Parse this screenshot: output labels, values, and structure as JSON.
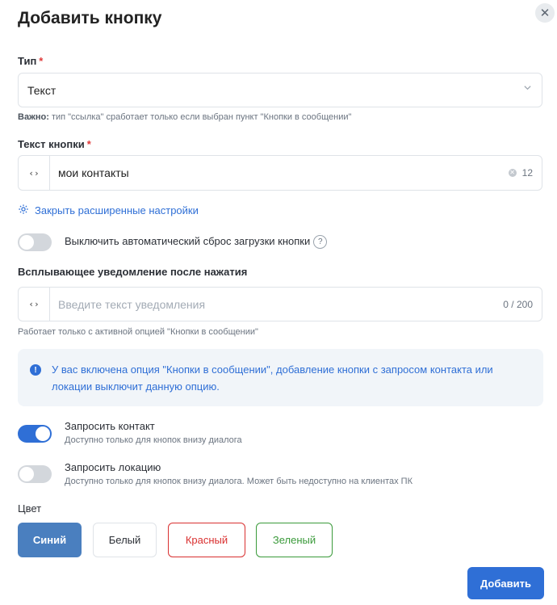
{
  "dialog": {
    "title": "Добавить кнопку",
    "close_label": "✕"
  },
  "type_field": {
    "label": "Тип",
    "required_mark": "*",
    "value": "Текст",
    "note_bold": "Важно:",
    "note_text": " тип \"ссылка\" сработает только если выбран пункт \"Кнопки в сообщении\""
  },
  "text_field": {
    "label": "Текст кнопки",
    "required_mark": "*",
    "code_label": "‹›",
    "value": "мои контакты",
    "counter": "12"
  },
  "advanced_link": {
    "label": "Закрыть расширенные настройки"
  },
  "auto_reset_toggle": {
    "label": "Выключить автоматический сброс загрузки кнопки",
    "help": "?",
    "on": false
  },
  "notification_field": {
    "label": "Всплывающее уведомление после нажатия",
    "code_label": "‹›",
    "placeholder": "Введите текст уведомления",
    "counter": "0 / 200",
    "hint": "Работает только с активной опцией \"Кнопки в сообщении\""
  },
  "info_box": {
    "icon": "!",
    "text": "У вас включена опция \"Кнопки в сообщении\", добавление кнопки с запросом контакта или локации выключит данную опцию."
  },
  "request_contact": {
    "title": "Запросить контакт",
    "subtitle": "Доступно только для кнопок внизу диалога",
    "on": true
  },
  "request_location": {
    "title": "Запросить локацию",
    "subtitle": "Доступно только для кнопок внизу диалога. Может быть недоступно на клиентах ПК",
    "on": false
  },
  "color": {
    "label": "Цвет",
    "options": [
      {
        "label": "Синий",
        "color": "#4a7fbf",
        "selected": true
      },
      {
        "label": "Белый",
        "color": "#ffffff",
        "selected": false
      },
      {
        "label": "Красный",
        "color": "#d93030",
        "selected": false
      },
      {
        "label": "Зеленый",
        "color": "#3a9a3a",
        "selected": false
      }
    ]
  },
  "submit": {
    "label": "Добавить"
  }
}
